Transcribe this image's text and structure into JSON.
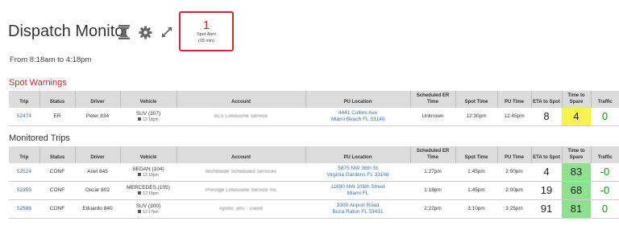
{
  "header": {
    "title": "Dispatch Monitor",
    "alert_count": "1",
    "alert_label_line1": "Spot Alert",
    "alert_label_line2": "(15 min)"
  },
  "time_range": "From 8:18am to 4:18pm",
  "warnings": {
    "title": "Spot Warnings",
    "columns": [
      "Trip",
      "Status",
      "Driver",
      "Vehicle",
      "Account",
      "PU Location",
      "Scheduled ER Time",
      "Spot Time",
      "PU Time",
      "ETA to Spot",
      "Time to Spare",
      "Traffic"
    ],
    "rows": [
      {
        "trip": "52474",
        "status": "ER",
        "driver": "Peter 834",
        "vehicle": "SUV (307)",
        "vehicle_time": "12:18pm",
        "account": "BLS Limousine Service",
        "pu_line1": "4441 Collins Ave",
        "pu_line2": "Miami Beach FL 33140",
        "sched_er": "Unknown",
        "spot": "12:30pm",
        "pu_time": "12:45pm",
        "eta": "8",
        "spare": "4",
        "traffic": "0"
      }
    ]
  },
  "monitored": {
    "title": "Monitored Trips",
    "columns": [
      "Trip",
      "Status",
      "Driver",
      "Vehicle",
      "Account",
      "PU Location",
      "Scheduled ER Time",
      "Spot Time",
      "PU Time",
      "ETA to Spot",
      "Time to Spare",
      "Traffic"
    ],
    "rows": [
      {
        "trip": "52524",
        "status": "CONF",
        "driver": "Ariel 845",
        "vehicle": "SEDAN (104)",
        "vehicle_time": "12:19pm",
        "account": "Worldwide Scheduled Services",
        "pu_line1": "5875 NW 36th St",
        "pu_line2": "Virginia Gardens FL 33166",
        "sched_er": "1:27pm",
        "spot": "1:45pm",
        "pu_time": "2:00pm",
        "eta": "4",
        "spare": "83",
        "traffic": "-0"
      },
      {
        "trip": "52359",
        "status": "CONF",
        "driver": "Oscar 802",
        "vehicle": "MERCEDES (105)",
        "vehicle_time": "12:18pm",
        "account": "Prestige Limousine Service Inc",
        "pu_line1": "11690 NW 105th Street",
        "pu_line2": "Miami FL",
        "sched_er": "1:18pm",
        "spot": "1:45pm",
        "pu_time": "2:00pm",
        "eta": "19",
        "spare": "68",
        "traffic": "-0"
      },
      {
        "trip": "52586",
        "status": "CONF",
        "driver": "Eduardo 840",
        "vehicle": "SUV (300)",
        "vehicle_time": "12:17pm",
        "account": "Apollo Jets - David",
        "pu_line1": "3300 Airport Road",
        "pu_line2": "Boca Raton FL 33431",
        "sched_er": "2:22pm",
        "spot": "3:10pm",
        "pu_time": "3:25pm",
        "eta": "91",
        "spare": "81",
        "traffic": "0"
      }
    ]
  },
  "colors": {
    "accent_red": "#cc2b2b",
    "warning_yellow": "#f6f24e",
    "ok_green": "#8fe08f",
    "traffic_green": "#1a8f1a",
    "link_blue": "#3a6fb0"
  },
  "icons": [
    "hourglass-icon",
    "gear-icon",
    "expand-icon"
  ]
}
